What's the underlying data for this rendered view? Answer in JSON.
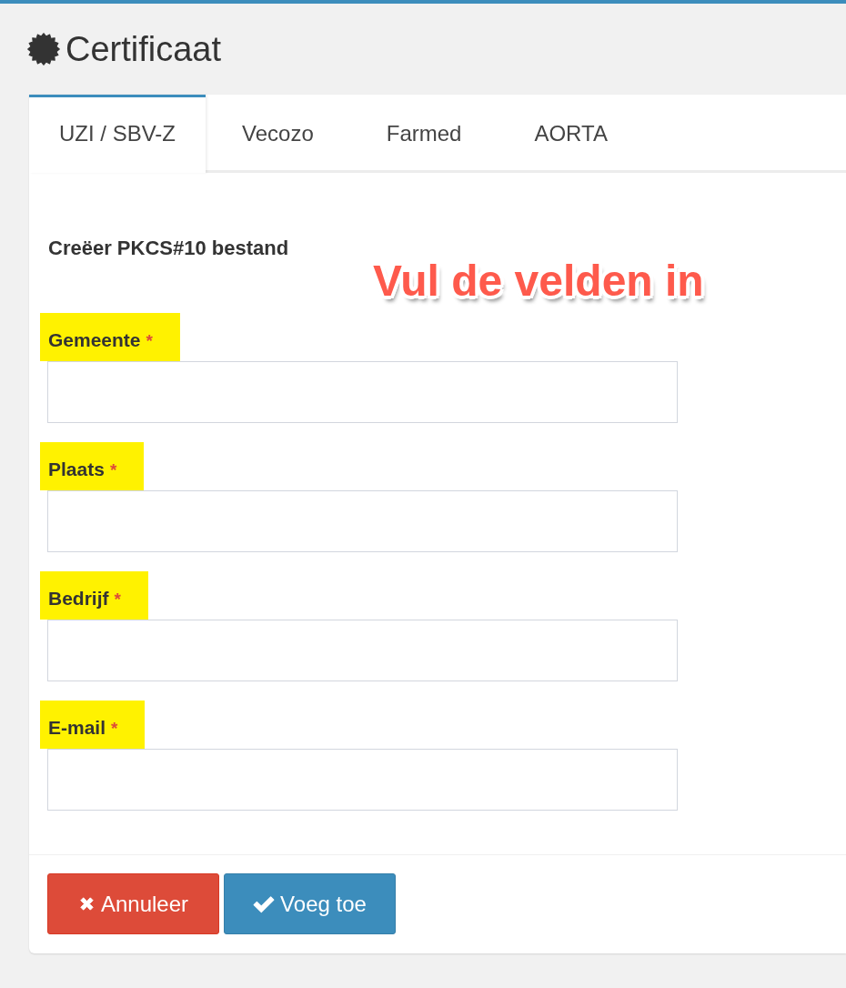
{
  "page": {
    "title": "Certificaat"
  },
  "tabs": [
    {
      "label": "UZI / SBV-Z",
      "selected": true
    },
    {
      "label": "Vecozo",
      "selected": false
    },
    {
      "label": "Farmed",
      "selected": false
    },
    {
      "label": "AORTA",
      "selected": false
    }
  ],
  "form": {
    "heading": "Creëer PKCS#10 bestand",
    "fields": [
      {
        "label": "Gemeente",
        "required_mark": "*",
        "highlighted": true
      },
      {
        "label": "Plaats",
        "required_mark": "*",
        "highlighted": true
      },
      {
        "label": "Bedrijf",
        "required_mark": "*",
        "highlighted": true
      },
      {
        "label": "E-mail",
        "required_mark": "*",
        "highlighted": true
      }
    ]
  },
  "buttons": [
    {
      "label": "Annuleer",
      "kind": "cancel"
    },
    {
      "label": "Voeg toe",
      "kind": "submit"
    }
  ],
  "annotation": {
    "text": "Vul de velden in"
  }
}
